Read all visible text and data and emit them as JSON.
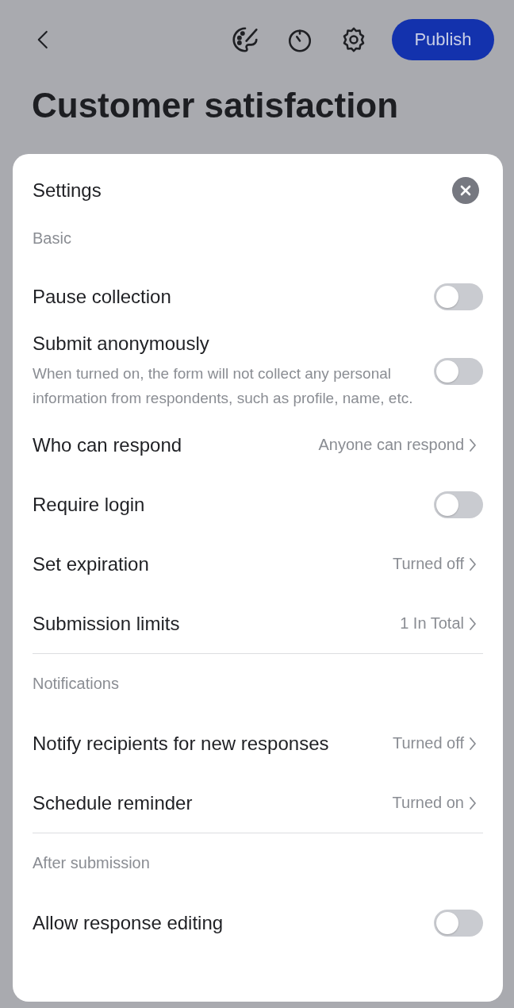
{
  "header": {
    "publish_button": "Publish"
  },
  "form": {
    "title": "Customer satisfaction"
  },
  "settings": {
    "title": "Settings",
    "sections": [
      {
        "heading": "Basic",
        "items": [
          {
            "kind": "toggle",
            "label": "Pause collection",
            "on": false
          },
          {
            "kind": "toggle",
            "label": "Submit anonymously",
            "description": "When turned on, the form will not collect any personal information from respondents, such as profile, name, etc.",
            "on": false
          },
          {
            "kind": "link",
            "label": "Who can respond",
            "value": "Anyone can respond"
          },
          {
            "kind": "toggle",
            "label": "Require login",
            "on": false
          },
          {
            "kind": "link",
            "label": "Set expiration",
            "value": "Turned off"
          },
          {
            "kind": "link",
            "label": "Submission limits",
            "value": "1 In Total"
          }
        ]
      },
      {
        "heading": "Notifications",
        "items": [
          {
            "kind": "link",
            "label": "Notify recipients for new responses",
            "value": "Turned off"
          },
          {
            "kind": "link",
            "label": "Schedule reminder",
            "value": "Turned on"
          }
        ]
      },
      {
        "heading": "After submission",
        "items": [
          {
            "kind": "toggle",
            "label": "Allow response editing",
            "on": false
          }
        ]
      }
    ]
  }
}
